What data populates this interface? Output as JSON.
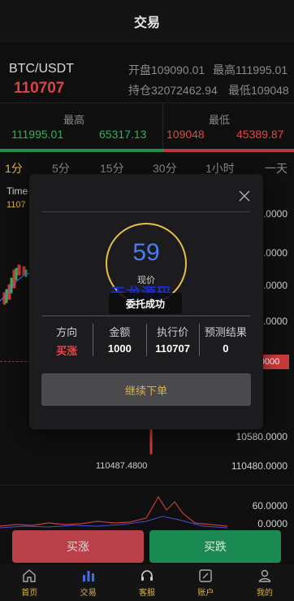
{
  "header": {
    "title": "交易"
  },
  "ticker": {
    "pair": "BTC/USDT",
    "price": "110707",
    "open": "开盘109090.01",
    "high": "最高111995.01",
    "hold": "持仓32072462.94",
    "low": "最低109048"
  },
  "high_low": {
    "high_label": "最高",
    "low_label": "最低",
    "high_values": [
      "111995.01",
      "65317.13"
    ],
    "low_values": [
      "109048",
      "45389.87"
    ]
  },
  "tabs": [
    "1分",
    "5分",
    "15分",
    "30分",
    "1小时",
    "一天"
  ],
  "active_tab": 0,
  "chart": {
    "label": "Time",
    "sub": "1107",
    "axis": [
      "0.0000",
      "0.0000",
      "0.0000",
      "0.0000",
      "10580.0000",
      "110480.0000"
    ],
    "current_tag": "0000",
    "low_mark": "110487.4800",
    "vol_axis": [
      "60.0000",
      "0.0000"
    ]
  },
  "modal": {
    "countdown": "59",
    "countdown_label": "现价",
    "watermark": "天龙源码",
    "toast": "委托成功",
    "headers": [
      "方向",
      "金额",
      "执行价",
      "预测结果"
    ],
    "values": [
      "买涨",
      "1000",
      "110707",
      "0"
    ],
    "continue_label": "继续下单"
  },
  "buttons": {
    "buy_up": "买涨",
    "buy_down": "买跌"
  },
  "nav": [
    {
      "label": "首页",
      "icon": "home-icon"
    },
    {
      "label": "交易",
      "icon": "chart-icon"
    },
    {
      "label": "客服",
      "icon": "headset-icon"
    },
    {
      "label": "账户",
      "icon": "wallet-icon"
    },
    {
      "label": "我的",
      "icon": "user-icon"
    }
  ],
  "colors": {
    "accent": "#d9b04a",
    "up": "#e04848",
    "down": "#2eb35a"
  }
}
